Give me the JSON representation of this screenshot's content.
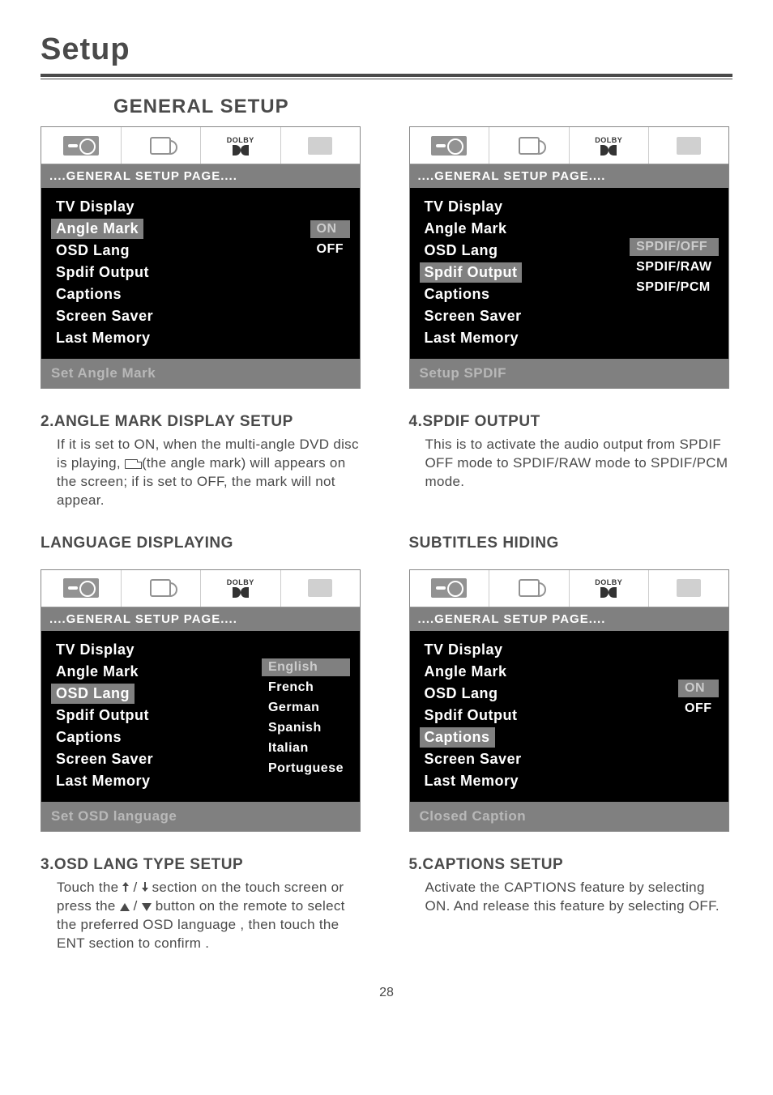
{
  "page": {
    "title": "Setup",
    "section_title": "GENERAL SETUP",
    "footer_num": "28"
  },
  "tabs": {
    "dolby_label": "DOLBY"
  },
  "card1": {
    "header": "....GENERAL SETUP PAGE....",
    "items": [
      "TV Display",
      "Angle Mark",
      "OSD Lang",
      "Spdif Output",
      "Captions",
      "Screen Saver",
      "Last Memory"
    ],
    "selected_index": 1,
    "options": [
      "ON",
      "OFF"
    ],
    "option_selected": 0,
    "footer": "Set Angle Mark"
  },
  "card2": {
    "header": "....GENERAL SETUP PAGE....",
    "items": [
      "TV Display",
      "Angle Mark",
      "OSD Lang",
      "Spdif Output",
      "Captions",
      "Screen Saver",
      "Last Memory"
    ],
    "selected_index": 3,
    "options": [
      "SPDIF/OFF",
      "SPDIF/RAW",
      "SPDIF/PCM"
    ],
    "option_selected": 0,
    "footer": "Setup SPDIF"
  },
  "card3": {
    "header": "....GENERAL SETUP PAGE....",
    "items": [
      "TV Display",
      "Angle Mark",
      "OSD Lang",
      "Spdif Output",
      "Captions",
      "Screen Saver",
      "Last Memory"
    ],
    "selected_index": 2,
    "options": [
      "English",
      "French",
      "German",
      "Spanish",
      "Italian",
      "Portuguese"
    ],
    "option_selected": 0,
    "footer": "Set OSD language"
  },
  "card4": {
    "header": "....GENERAL SETUP PAGE....",
    "items": [
      "TV Display",
      "Angle Mark",
      "OSD Lang",
      "Spdif Output",
      "Captions",
      "Screen Saver",
      "Last Memory"
    ],
    "selected_index": 4,
    "options": [
      "ON",
      "OFF"
    ],
    "option_selected": 0,
    "footer": "Closed Caption"
  },
  "text": {
    "h2_title": "2.ANGLE MARK DISPLAY SETUP",
    "h2_body1": "If it is set to ON, when the multi-angle DVD disc is playing, ",
    "h2_body2": " (the angle mark) will appears on the screen; if is set to OFF, the mark will not appear.",
    "h4_title": "4.SPDIF OUTPUT",
    "h4_body": "This is to activate the audio output from SPDIF OFF mode to SPDIF/RAW mode to SPDIF/PCM mode.",
    "lang_title": "LANGUAGE DISPLAYING",
    "sub_title": "SUBTITLES HIDING",
    "h3_title": "3.OSD LANG TYPE SETUP",
    "h3_body1": "Touch the ",
    "h3_body2": " section on the touch screen or press the ",
    "h3_body3": " button on the remote to select the preferred OSD language , then touch the ENT section to confirm .",
    "h5_title": "5.CAPTIONS SETUP",
    "h5_body": "Activate the CAPTIONS feature by selecting ON.  And release this feature by selecting OFF."
  }
}
